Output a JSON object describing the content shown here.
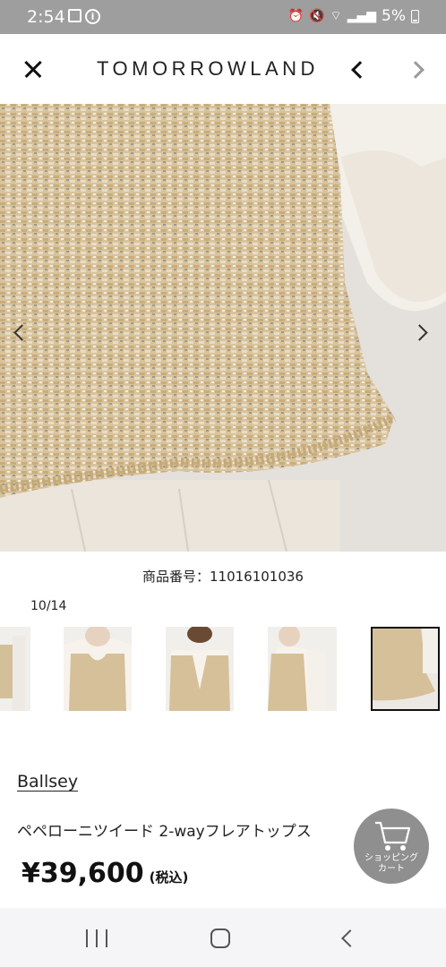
{
  "status_bar": {
    "time": "2:54",
    "battery": "5%"
  },
  "header": {
    "brand": "TOMORROWLAND"
  },
  "product": {
    "code": "商品番号：11016101036",
    "image_counter": "10/14",
    "brand": "Ballsey",
    "name": "ペペローニツイード 2-wayフレアトップス",
    "price": "¥39,600",
    "tax_label": "(税込)"
  },
  "cart": {
    "label_line1": "ショッピング",
    "label_line2": "カート"
  },
  "colors": {
    "status_bar": "#9e9e9e",
    "cart_button": "#8a8a8a",
    "tweed": "#d6c09a"
  },
  "icons": [
    "close-icon",
    "chevron-left-icon",
    "chevron-right-icon",
    "cart-icon",
    "recent-apps-icon",
    "home-icon",
    "back-icon"
  ]
}
